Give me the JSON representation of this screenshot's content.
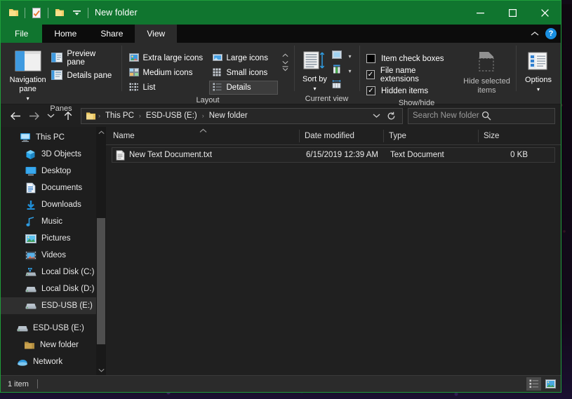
{
  "window": {
    "title": "New folder",
    "quick_access": [
      "folder-icon",
      "properties-icon",
      "new-folder-icon",
      "customize-dropdown-icon"
    ],
    "controls": {
      "minimize": "—",
      "maximize": "☐",
      "close": "✕"
    },
    "colors": {
      "titlebar": "#10752f",
      "border": "#1f9d3a",
      "background": "#202020",
      "accent": "#1a8fe0"
    }
  },
  "tabs": [
    {
      "label": "File",
      "state": "file-menu"
    },
    {
      "label": "Home",
      "state": "normal"
    },
    {
      "label": "Share",
      "state": "normal"
    },
    {
      "label": "View",
      "state": "active"
    }
  ],
  "tabrow_right": {
    "collapse_icon": "chevron-up-icon",
    "help_label": "?"
  },
  "ribbon": {
    "groups": [
      {
        "name": "panes",
        "label": "Panes",
        "big_button": {
          "label": "Navigation pane",
          "caret": "▾"
        },
        "small_buttons": [
          {
            "label": "Preview pane",
            "icon": "preview-pane-icon"
          },
          {
            "label": "Details pane",
            "icon": "details-pane-icon"
          }
        ]
      },
      {
        "name": "layout",
        "label": "Layout",
        "options": [
          {
            "label": "Extra large icons",
            "selected": false
          },
          {
            "label": "Large icons",
            "selected": false
          },
          {
            "label": "Medium icons",
            "selected": false
          },
          {
            "label": "Small icons",
            "selected": false
          },
          {
            "label": "List",
            "selected": false
          },
          {
            "label": "Details",
            "selected": true
          }
        ],
        "scroll": {
          "up": "▲",
          "down": "▼",
          "more": "≡"
        }
      },
      {
        "name": "current-view",
        "label": "Current view",
        "big_button": {
          "label": "Sort by",
          "caret": "▾"
        },
        "small_buttons": [
          {
            "label": "",
            "icon": "add-columns-icon"
          },
          {
            "label": "",
            "icon": "column-chart-icon"
          },
          {
            "label": "",
            "icon": "size-columns-icon"
          }
        ]
      },
      {
        "name": "show-hide",
        "label": "Show/hide",
        "checkboxes": [
          {
            "label": "Item check boxes",
            "checked": false
          },
          {
            "label": "File name extensions",
            "checked": true
          },
          {
            "label": "Hidden items",
            "checked": true
          }
        ],
        "hide_selected": {
          "label": "Hide selected items"
        }
      },
      {
        "name": "options",
        "label": "",
        "big_button": {
          "label": "Options",
          "caret": "▾"
        }
      }
    ]
  },
  "address_bar": {
    "back": "←",
    "forward": "→",
    "recent": "∨",
    "up": "↑",
    "breadcrumb": [
      "This PC",
      "ESD-USB (E:)",
      "New folder"
    ],
    "breadcrumb_sep": "›",
    "dropdown": "∨",
    "refresh": "⟳",
    "search_placeholder": "Search New folder",
    "search_value": "",
    "search_icon": "search-icon"
  },
  "sidebar": {
    "items": [
      {
        "label": "This PC",
        "icon": "this-pc-icon",
        "indent": 0,
        "selected": false
      },
      {
        "label": "3D Objects",
        "icon": "3d-objects-icon",
        "indent": 1,
        "selected": false
      },
      {
        "label": "Desktop",
        "icon": "desktop-icon",
        "indent": 1,
        "selected": false
      },
      {
        "label": "Documents",
        "icon": "documents-icon",
        "indent": 1,
        "selected": false
      },
      {
        "label": "Downloads",
        "icon": "downloads-icon",
        "indent": 1,
        "selected": false
      },
      {
        "label": "Music",
        "icon": "music-icon",
        "indent": 1,
        "selected": false
      },
      {
        "label": "Pictures",
        "icon": "pictures-icon",
        "indent": 1,
        "selected": false
      },
      {
        "label": "Videos",
        "icon": "videos-icon",
        "indent": 1,
        "selected": false
      },
      {
        "label": "Local Disk (C:)",
        "icon": "local-disk-c-icon",
        "indent": 1,
        "selected": false
      },
      {
        "label": "Local Disk (D:)",
        "icon": "drive-icon",
        "indent": 1,
        "selected": false
      },
      {
        "label": "ESD-USB (E:)",
        "icon": "usb-drive-icon",
        "indent": 1,
        "selected": true
      },
      {
        "label": "ESD-USB (E:)",
        "icon": "usb-drive-icon",
        "indent": 0,
        "selected": false
      },
      {
        "label": "New folder",
        "icon": "folder-icon",
        "indent": 1,
        "selected": false
      },
      {
        "label": "Network",
        "icon": "network-icon",
        "indent": 0,
        "selected": false
      }
    ],
    "scroll": {
      "up": "▲",
      "down": "▼"
    }
  },
  "file_list": {
    "sort_indicator": "▲",
    "columns": [
      "Name",
      "Date modified",
      "Type",
      "Size"
    ],
    "rows": [
      {
        "name": "New Text Document.txt",
        "date_modified": "6/15/2019 12:39 AM",
        "type": "Text Document",
        "size": "0 KB",
        "icon": "text-document-icon"
      }
    ]
  },
  "status_bar": {
    "item_count": "1 item",
    "view_buttons": [
      {
        "name": "details-view-button",
        "active": true
      },
      {
        "name": "large-icons-view-button",
        "active": false
      }
    ]
  }
}
